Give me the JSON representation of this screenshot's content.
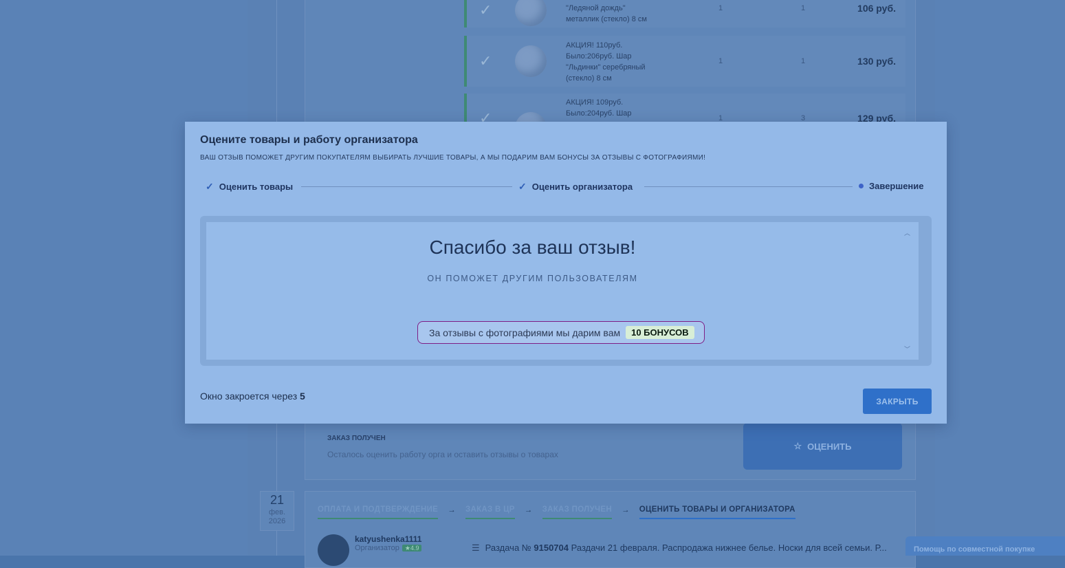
{
  "background": {
    "order_rows": [
      {
        "name": "\"Ледяной дождь\"\nметаллик (стекло) 8 см",
        "qty_ordered": "1",
        "qty_received": "1",
        "price": "106 руб."
      },
      {
        "name": "АКЦИЯ! 110руб.\nБыло:206руб. Шар\n\"Льдинки\" серебряный\n(стекло) 8 см",
        "qty_ordered": "1",
        "qty_received": "1",
        "price": "130 руб."
      },
      {
        "name": "АКЦИЯ! 109руб.\nБыло:204руб. Шар",
        "qty_ordered": "1",
        "qty_received": "3",
        "price": "129 руб."
      }
    ],
    "status_title": "ЗАКАЗ ПОЛУЧЕН",
    "status_text": "Осталось оценить работу орга и оставить отзывы о товарах",
    "rate_button": "ОЦЕНИТЬ",
    "date": {
      "day": "21",
      "month": "фев.",
      "year": "2026"
    },
    "steps": [
      "ОПЛАТА И ПОДТВЕРЖДЕНИЕ",
      "ЗАКАЗ В ЦР",
      "ЗАКАЗ ПОЛУЧЕН",
      "ОЦЕНИТЬ ТОВАРЫ И ОРГАНИЗАТОРА"
    ],
    "organizer": {
      "name": "katyushenka1111",
      "role": "Организатор",
      "rating": "4.9"
    },
    "distribution": {
      "prefix": "Раздача №",
      "number": "9150704",
      "text": "Раздачи 21 февраля. Распродажа нижнее белье. Носки для всей семьи. Р..."
    },
    "help_button": "Помощь по совместной покупке"
  },
  "modal": {
    "title": "Оцените товары и работу организатора",
    "subtitle": "ВАШ ОТЗЫВ ПОМОЖЕТ ДРУГИМ ПОКУПАТЕЛЯМ ВЫБИРАТЬ ЛУЧШИЕ ТОВАРЫ, А МЫ ПОДАРИМ ВАМ БОНУСЫ ЗА ОТЗЫВЫ С ФОТОГРАФИЯМИ!",
    "steps": [
      {
        "label": "Оценить товары",
        "state": "done"
      },
      {
        "label": "Оценить организатора",
        "state": "done"
      },
      {
        "label": "Завершение",
        "state": "current"
      }
    ],
    "thanks_title": "Спасибо за ваш отзыв!",
    "thanks_subtitle": "ОН ПОМОЖЕТ ДРУГИМ ПОЛЬЗОВАТЕЛЯМ",
    "bonus_text": "За отзывы с фотографиями мы дарим вам",
    "bonus_amount": "10 БОНУСОВ",
    "close_timer_label": "Окно закроется через",
    "close_timer_value": "5",
    "close_button": "ЗАКРЫТЬ"
  }
}
